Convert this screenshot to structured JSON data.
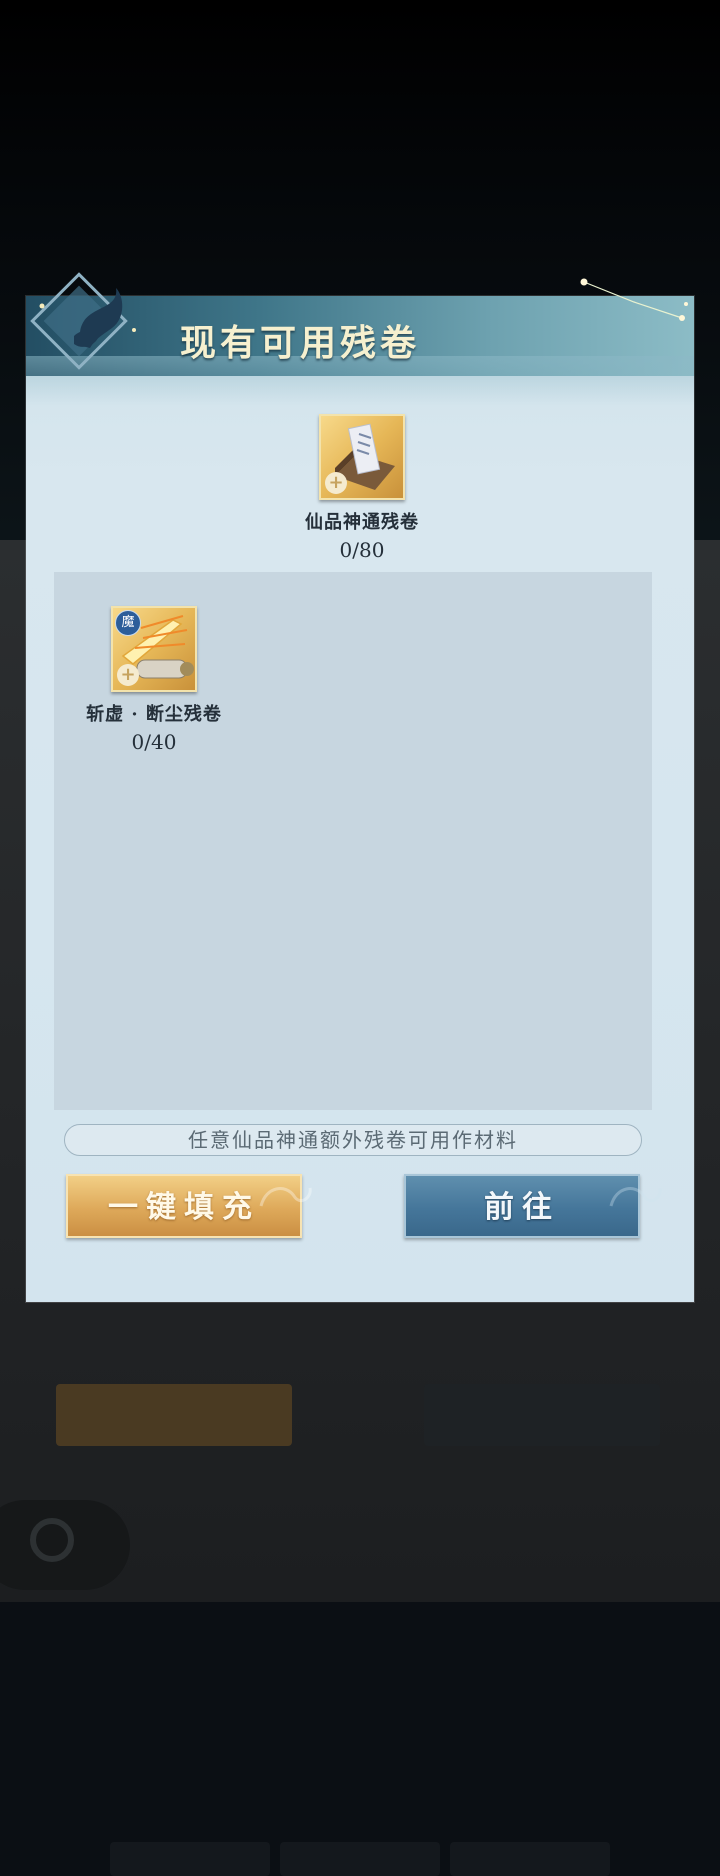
{
  "dialog": {
    "title": "现有可用残卷",
    "required_item": {
      "name": "仙品神通残卷",
      "count": "0/80",
      "icon": "scroll-box-icon"
    },
    "materials": [
      {
        "name": "斩虚 · 断尘残卷",
        "count": "0/40",
        "badge": "魔",
        "icon": "golden-sword-scroll-icon"
      }
    ],
    "hint": "任意仙品神通额外残卷可用作材料",
    "buttons": {
      "fill": "一键填充",
      "go": "前往"
    }
  },
  "colors": {
    "gold_button": "#dea95a",
    "blue_button": "#45769a",
    "panel": "#d6e6ef"
  }
}
